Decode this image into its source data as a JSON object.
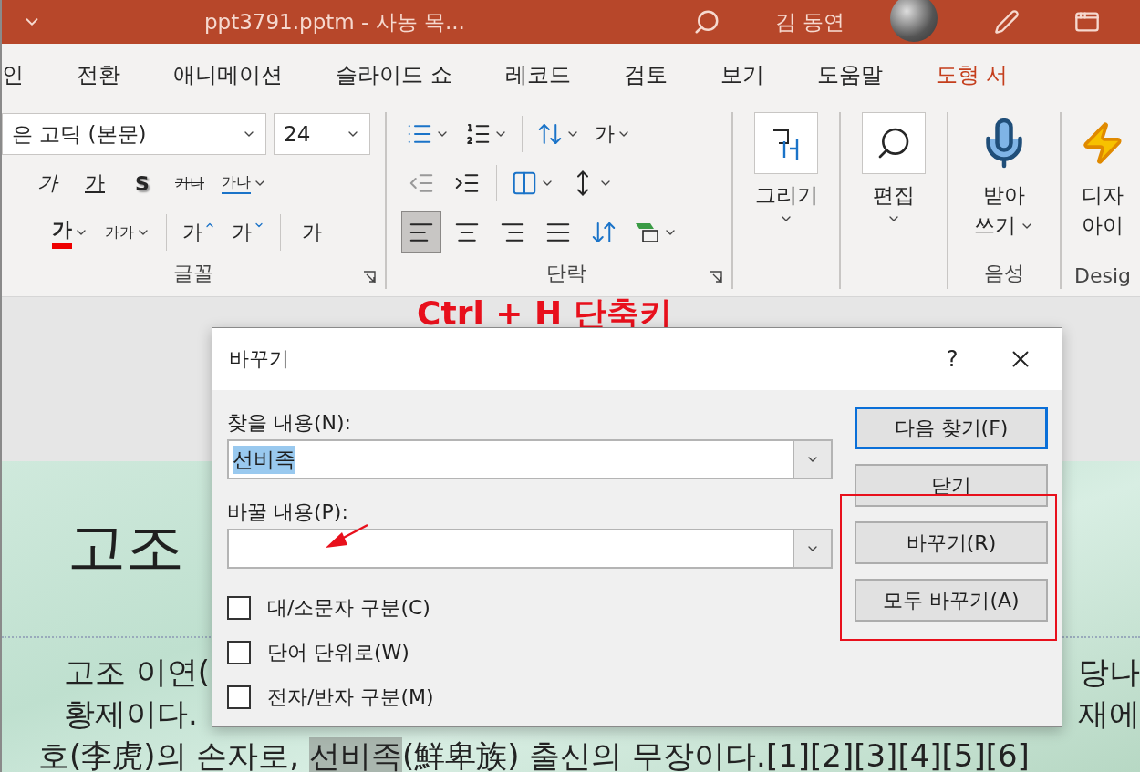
{
  "title_bar": {
    "title": "ppt3791.pptm  -  사농 목...",
    "user": "김 동연"
  },
  "tabs": [
    {
      "label": "인",
      "kind": "normal"
    },
    {
      "label": "전환",
      "kind": "normal"
    },
    {
      "label": "애니메이션",
      "kind": "normal"
    },
    {
      "label": "슬라이드 쇼",
      "kind": "normal"
    },
    {
      "label": "레코드",
      "kind": "normal"
    },
    {
      "label": "검토",
      "kind": "normal"
    },
    {
      "label": "보기",
      "kind": "normal"
    },
    {
      "label": "도움말",
      "kind": "normal"
    },
    {
      "label": "도형 서",
      "kind": "contextual"
    }
  ],
  "font_group": {
    "label": "글꼴",
    "font_name": "은 고딕 (본문)",
    "font_size": "24",
    "toolbars": [
      {
        "items": [
          {
            "kind": "italic",
            "text": "가"
          },
          {
            "kind": "underline",
            "text": "가"
          },
          {
            "kind": "shadow",
            "text": "S"
          },
          {
            "kind": "strike",
            "text": "가나"
          },
          {
            "kind": "spacing",
            "text": "가나",
            "dropdown": true
          }
        ]
      },
      {
        "items": [
          {
            "kind": "font_color",
            "text": "가",
            "dropdown": true
          },
          {
            "kind": "case",
            "text": "가가",
            "dropdown": true
          },
          {
            "kind": "grow",
            "text": "가",
            "group_start": true
          },
          {
            "kind": "shrink",
            "text": "가"
          },
          {
            "kind": "clear",
            "text": "가",
            "group_start": true
          }
        ]
      }
    ]
  },
  "paragraph_group": {
    "label": "단락",
    "toolbars": [
      {
        "items": [
          {
            "kind": "bullets",
            "dropdown": true
          },
          {
            "kind": "numbering",
            "dropdown": true
          },
          {
            "kind": "line_spacing",
            "dropdown": true,
            "group_start": true
          },
          {
            "kind": "text_direction",
            "text": "가",
            "dropdown": true
          }
        ]
      },
      {
        "items": [
          {
            "kind": "indent_less"
          },
          {
            "kind": "indent_more"
          },
          {
            "kind": "columns",
            "dropdown": true,
            "group_start": true
          },
          {
            "kind": "align_text",
            "dropdown": true
          }
        ]
      },
      {
        "items": [
          {
            "kind": "align_left",
            "selected": true
          },
          {
            "kind": "align_center",
            "selected": false
          },
          {
            "kind": "align_right",
            "selected": false
          },
          {
            "kind": "justify",
            "selected": false
          },
          {
            "kind": "distributed",
            "selected": false
          },
          {
            "kind": "smartart",
            "dropdown": true
          }
        ]
      }
    ]
  },
  "large_groups": [
    {
      "kind": "draw",
      "lines": [
        "그리기"
      ],
      "dropdown": true
    },
    {
      "kind": "edit",
      "lines": [
        "편집"
      ],
      "dropdown": true
    },
    {
      "kind": "dictate",
      "lines": [
        "받아",
        "쓰기"
      ],
      "dropdown": true,
      "group_label": "음성"
    },
    {
      "kind": "designer",
      "lines": [
        "디자",
        "아이"
      ],
      "group_label": "Desig"
    }
  ],
  "annotation": {
    "text": "Ctrl + H 단축키"
  },
  "slide": {
    "title": "고조",
    "body": [
      {
        "left": "고조 이연(",
        "right": "당나"
      },
      {
        "left": "황제이다.",
        "right": "재에"
      },
      {
        "before": "호(李虎)의 손자로, ",
        "highlight": "선비족",
        "after": "(鮮卑族) 출신의 무장이다.[1][2][3][4][5][6]"
      }
    ]
  },
  "dialog": {
    "title": "바꾸기",
    "help": "?",
    "find": {
      "label": "찾을 내용(N):",
      "value": "선비족",
      "value_selected": true
    },
    "replace": {
      "label": "바꿀 내용(P):"
    },
    "options": [
      {
        "label": "대/소문자 구분(C)",
        "checked": false
      },
      {
        "label": "단어 단위로(W)",
        "checked": false
      },
      {
        "label": "전자/반자 구분(M)",
        "checked": false
      }
    ],
    "buttons": [
      {
        "label": "다음 찾기(F)",
        "default": true
      },
      {
        "label": "닫기",
        "default": false
      },
      {
        "label": "바꾸기(R)",
        "default": false
      },
      {
        "label": "모두 바꾸기(A)",
        "default": false
      }
    ]
  }
}
